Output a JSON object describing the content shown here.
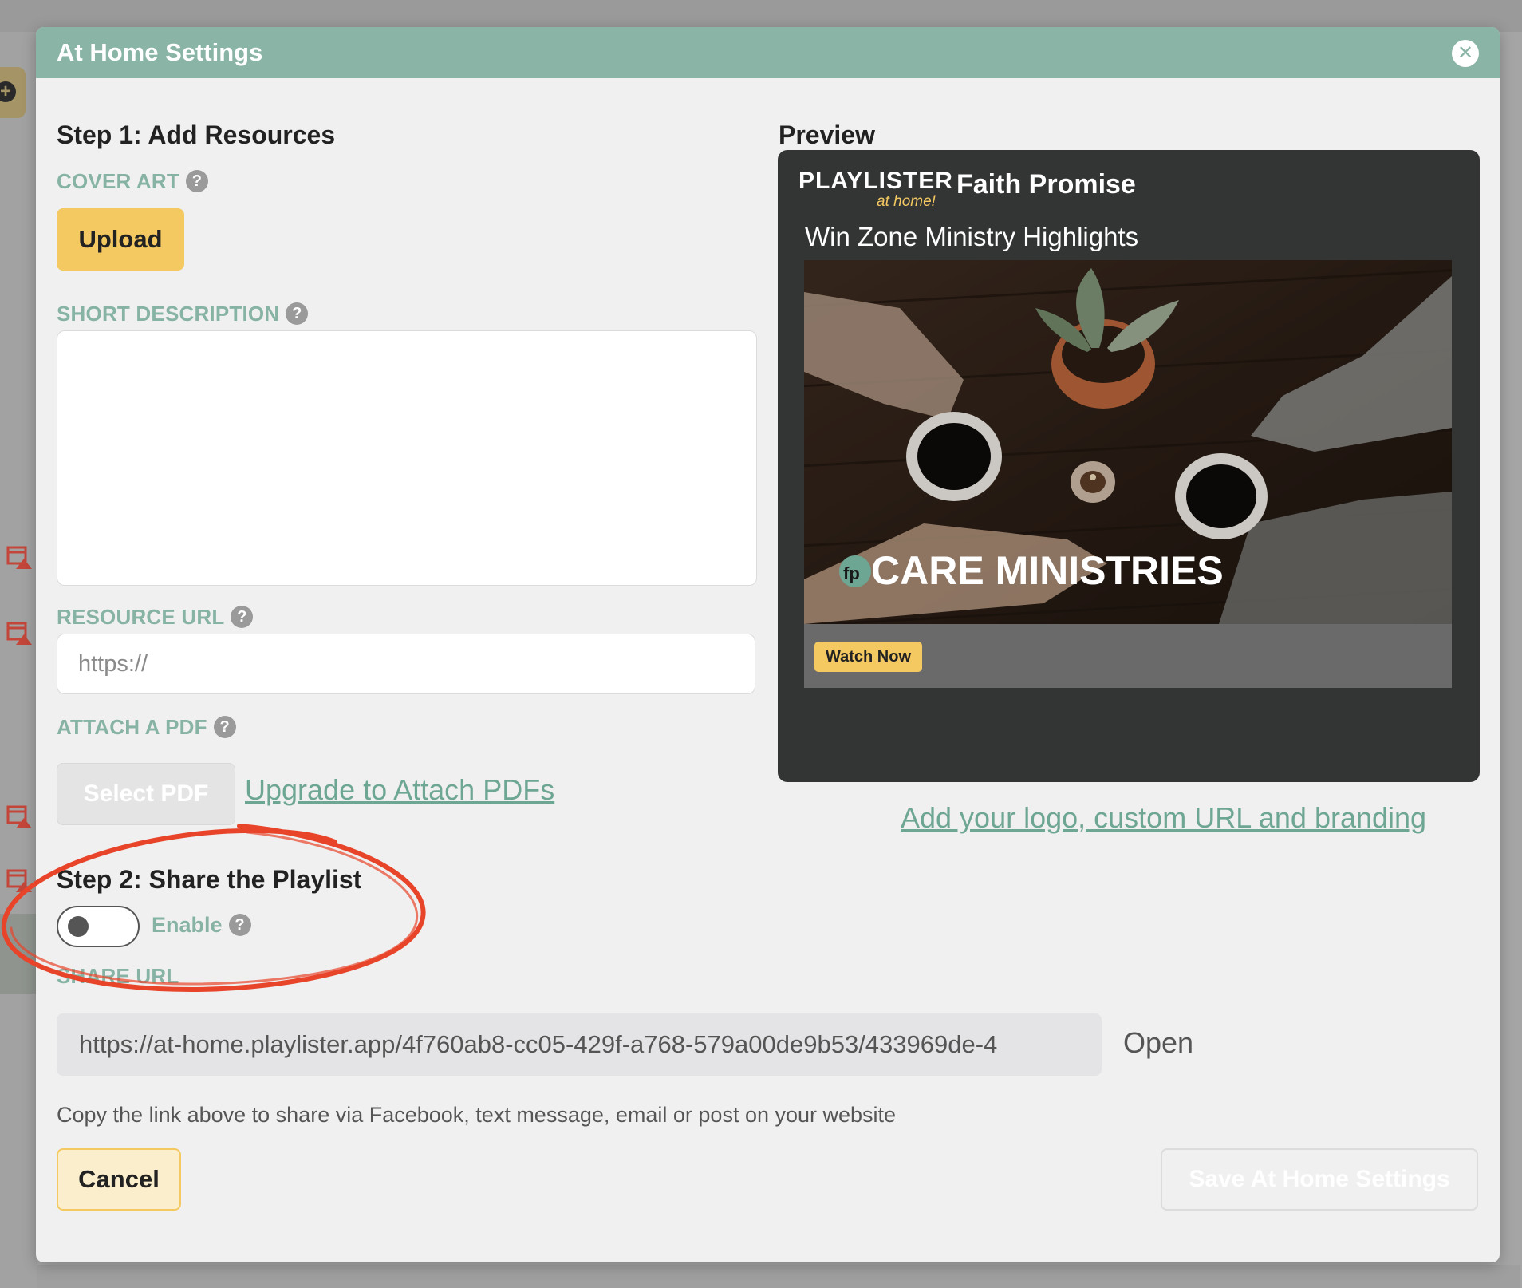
{
  "modal": {
    "title": "At Home Settings",
    "close_label": "✕"
  },
  "step1": {
    "title": "Step 1: Add Resources",
    "cover_art_label": "COVER ART",
    "upload_label": "Upload",
    "short_description_label": "SHORT DESCRIPTION",
    "resource_url_label": "RESOURCE URL",
    "resource_url_placeholder": "https://",
    "attach_pdf_label": "ATTACH A PDF",
    "select_pdf_label": "Select PDF",
    "upgrade_link": "Upgrade to Attach PDFs"
  },
  "step2": {
    "title": "Step 2: Share the Playlist",
    "enable_label": "Enable",
    "share_url_label": "SHARE URL",
    "share_url_value": "https://at-home.playlister.app/4f760ab8-cc05-429f-a768-579a00de9b53/433969de-4",
    "open_label": "Open",
    "copy_hint": "Copy the link above to share via Facebook, text message, email or post on your website"
  },
  "preview": {
    "title": "Preview",
    "logo_main": "PLAYLISTER",
    "logo_sub": "at home!",
    "church_name": "Faith Promise",
    "playlist_title": "Win Zone Ministry Highlights",
    "image_fp_mark": "fp",
    "image_caption": "CARE MINISTRIES",
    "watch_now_label": "Watch Now",
    "branding_link": "Add your logo, custom URL and branding"
  },
  "footer": {
    "cancel_label": "Cancel",
    "save_label": "Save At Home Settings"
  },
  "help_icon_glyph": "?",
  "colors": {
    "header": "#8ab5a6",
    "accent_label": "#86b3a3",
    "primary_button": "#f4c962",
    "annotation": "#e8442a"
  }
}
